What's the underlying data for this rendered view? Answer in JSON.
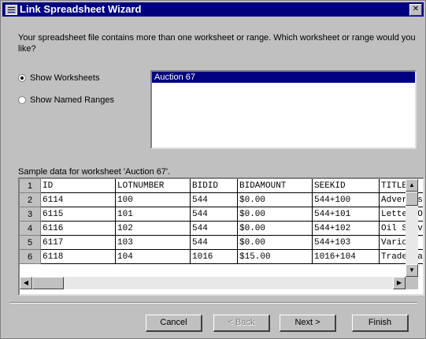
{
  "window": {
    "title": "Link Spreadsheet Wizard",
    "close_glyph": "✕"
  },
  "prompt": "Your spreadsheet file contains more than one worksheet or range. Which worksheet or range would you like?",
  "options": {
    "show_worksheets": {
      "label": "Show Worksheets",
      "checked": true
    },
    "show_named_ranges": {
      "label": "Show Named Ranges",
      "checked": false
    }
  },
  "worksheets": [
    "Auction 67"
  ],
  "sample": {
    "label": "Sample data for worksheet 'Auction 67'.",
    "rows": [
      [
        "1",
        "ID",
        "LOTNUMBER",
        "BIDID",
        "BIDAMOUNT",
        "SEEKID",
        "TITLE"
      ],
      [
        "2",
        "6114",
        "100",
        "544",
        "$0.00",
        "544+100",
        " Advertiseme"
      ],
      [
        "3",
        "6115",
        "101",
        "544",
        "$0.00",
        "544+101",
        "Letter Opene"
      ],
      [
        "4",
        "6116",
        "102",
        "544",
        "$0.00",
        "544+102",
        "Oil Stove Ad"
      ],
      [
        "5",
        "6117",
        "103",
        "544",
        "$0.00",
        "544+103",
        "Various play"
      ],
      [
        "6",
        "6118",
        "104",
        "1016",
        "$15.00",
        "1016+104",
        "Trade Cards"
      ]
    ]
  },
  "buttons": {
    "cancel": "Cancel",
    "back": "< Back",
    "next": "Next >",
    "finish": "Finish"
  }
}
